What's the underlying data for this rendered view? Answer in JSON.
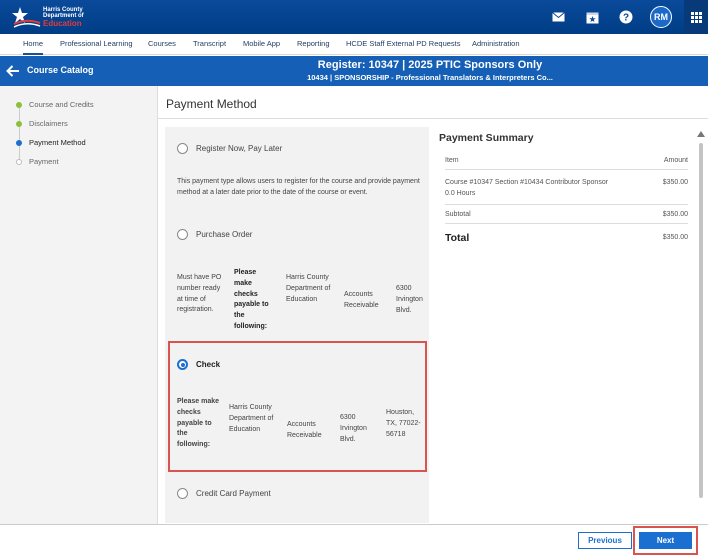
{
  "header": {
    "logo_lines": [
      "Harris County",
      "Department of",
      "Education"
    ],
    "avatar_initials": "RM",
    "icons": [
      "mail-icon",
      "calendar-star-icon",
      "help-icon",
      "apps-grid-icon"
    ]
  },
  "nav": {
    "tabs": [
      "Home",
      "Professional Learning",
      "Courses",
      "Transcript",
      "Mobile App",
      "Reporting",
      "HCDE Staff External PD Requests",
      "Administration"
    ],
    "active": "Home"
  },
  "titlebar": {
    "back_label": "Course Catalog",
    "title": "Register: 10347 | 2025 PTIC Sponsors Only",
    "subtitle": "10434 | SPONSORSHIP - Professional Translators & Interpreters Co..."
  },
  "steps": [
    {
      "label": "Course and Credits",
      "state": "done"
    },
    {
      "label": "Disclaimers",
      "state": "done"
    },
    {
      "label": "Payment Method",
      "state": "current"
    },
    {
      "label": "Payment",
      "state": "todo"
    }
  ],
  "page_heading": "Payment Method",
  "payment_options": {
    "register_now": {
      "label": "Register Now, Pay Later",
      "description": "This payment type allows users to register for the course and provide payment method at a later date prior to the date of the course or event."
    },
    "purchase_order": {
      "label": "Purchase Order",
      "details": [
        "Must have PO number ready at time of registration.",
        "Please make checks payable to the following:",
        "Harris County Department of Education",
        "Accounts Receivable",
        "6300 Irvington Blvd."
      ]
    },
    "check": {
      "label": "Check",
      "selected": true,
      "details": [
        "Please make checks payable to the following:",
        "Harris County Department of Education",
        "Accounts Receivable",
        "6300 Irvington Blvd.",
        "Houston, TX, 77022-56718"
      ]
    },
    "credit_card": {
      "label": "Credit Card Payment"
    }
  },
  "summary": {
    "title": "Payment Summary",
    "col_item": "Item",
    "col_amount": "Amount",
    "line_item": "Course #10347 Section #10434 Contributor Sponsor",
    "line_hours": "0.0 Hours",
    "line_amount": "$350.00",
    "subtotal_label": "Subtotal",
    "subtotal": "$350.00",
    "total_label": "Total",
    "total": "$350.00"
  },
  "footer": {
    "previous": "Previous",
    "next": "Next"
  },
  "colors": {
    "header": "#003d86",
    "titlebar": "#1560b6",
    "accent": "#1b6fd1",
    "highlight": "#d9534f",
    "done_step": "#8cbf3a"
  }
}
